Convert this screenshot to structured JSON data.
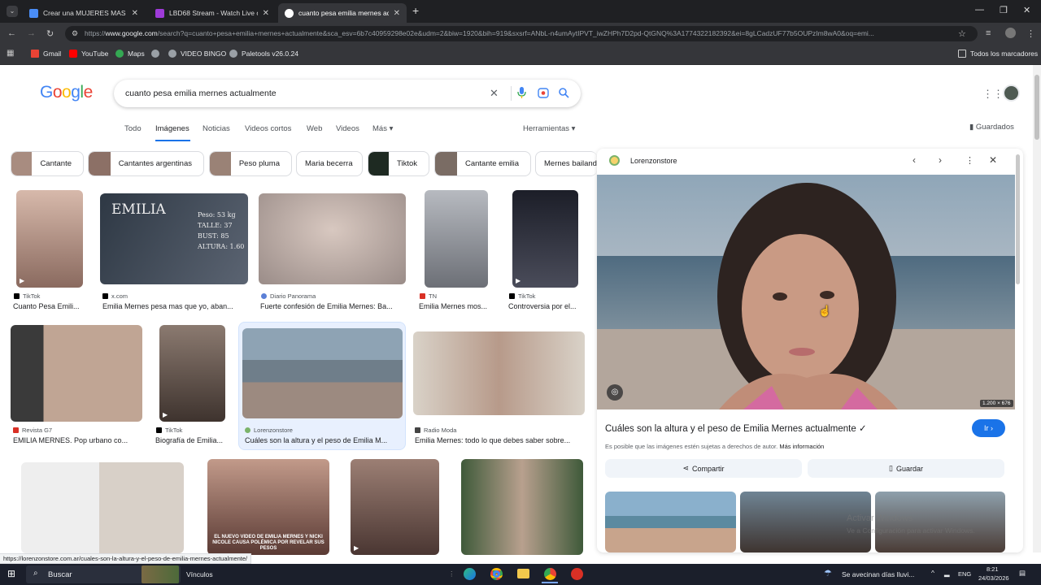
{
  "browser": {
    "tabs": [
      {
        "title": "Crear una MUJERES MAS HERMO",
        "color": "#4a8df7"
      },
      {
        "title": "LBD68 Stream - Watch Live on",
        "color": "#9e3bd8"
      },
      {
        "title": "cuanto pesa emilia mernes actu",
        "color": "#ffffff"
      }
    ],
    "new_tab": "+",
    "url_prefix": "https://",
    "url_host": "www.google.com",
    "url_rest": "/search?q=cuanto+pesa+emilia+mernes+actualmente&sca_esv=6b7c40959298e02e&udm=2&biw=1920&bih=919&sxsrf=ANbL-n4umAytIPVT_iwZHPh7D2pd-QtGNQ%3A1774322182392&ei=8gLCadzUF77b5OUPzIm8wA0&oq=emi...",
    "bookmarks": [
      "Gmail",
      "YouTube",
      "Maps",
      "VIDEO BINGO",
      "Paletools v26.0.24"
    ],
    "bookmarks_all": "Todos los marcadores"
  },
  "google": {
    "logo": "Google",
    "query": "cuanto pesa emilia mernes actualmente",
    "tabs": [
      "Todo",
      "Imágenes",
      "Noticias",
      "Videos cortos",
      "Web",
      "Videos",
      "Más"
    ],
    "herramientas": "Herramientas",
    "guardados": "Guardados",
    "chips": [
      "Cantante",
      "Cantantes argentinas",
      "Peso pluma",
      "Maria becerra",
      "Tiktok",
      "Cantante emilia",
      "Mernes bailando"
    ]
  },
  "results": [
    {
      "source": "TikTok",
      "caption": "Cuanto Pesa Emili...",
      "color": "#c9a89a"
    },
    {
      "source": "x.com",
      "caption": "Emilia Mernes pesa mas que yo, aban...",
      "color": "#3a4452"
    },
    {
      "source": "Diario Panorama",
      "caption": "Fuerte confesión de Emilia Mernes: Ba...",
      "color": "#b8a08e"
    },
    {
      "source": "TN",
      "caption": "Emilia Mernes mos...",
      "color": "#8d8f94"
    },
    {
      "source": "TikTok",
      "caption": "Controversia por el...",
      "color": "#2a2c36"
    },
    {
      "source": "Revista G7",
      "caption": "EMILIA MERNES. Pop urbano co...",
      "color": "#9c8c84"
    },
    {
      "source": "TikTok",
      "caption": "Biografía de Emilia...",
      "color": "#6e6058"
    },
    {
      "source": "Lorenzonstore",
      "caption": "Cuáles son la altura y el peso de Emilia M...",
      "color": "#7b8a96"
    },
    {
      "source": "Radio Moda",
      "caption": "Emilia Mernes: todo lo que debes saber sobre...",
      "color": "#b49c8c"
    },
    {
      "source": "",
      "caption": "",
      "color": "#5a4c46"
    },
    {
      "source": "",
      "caption": "",
      "color": "#a48878"
    },
    {
      "source": "",
      "caption": "",
      "color": "#7e6a62"
    },
    {
      "source": "",
      "caption": "",
      "color": "#4c5a48"
    }
  ],
  "overlay_text": {
    "r1c2": "EMILIA",
    "r1c2b": "Peso: 53 kg TALLE: 37 BUST: 85 ALTURA: 1.60",
    "r3c2": "EL NUEVO VIDEO DE EMILIA MERNES Y NICKI NICOLE CAUSA POLÉMICA POR REVELAR SUS PESOS"
  },
  "panel": {
    "source": "Lorenzonstore",
    "dimensions": "1.200 × 676",
    "title": "Cuáles son la altura y el peso de Emilia Mernes actualmente ✓",
    "go_button": "Ir",
    "note": "Es posible que las imágenes estén sujetas a derechos de autor.",
    "note_link": "Más información",
    "share": "Compartir",
    "save": "Guardar"
  },
  "status_url": "https://lorenzonstore.com.ar/cuales-son-la-altura-y-el-peso-de-emilia-mernes-actualmente/",
  "windows_watermark": {
    "line1": "Activar Windows",
    "line2": "Ve a Configuración para activar Windows."
  },
  "taskbar": {
    "search": "Buscar",
    "vinculos": "Vínculos",
    "weather": "Se avecinan días lluvi...",
    "lang": "ENG",
    "time": "8:21",
    "date": "24/03/2026"
  },
  "colors": {
    "accent": "#1a73e8",
    "chrome_dark": "#35363a"
  }
}
